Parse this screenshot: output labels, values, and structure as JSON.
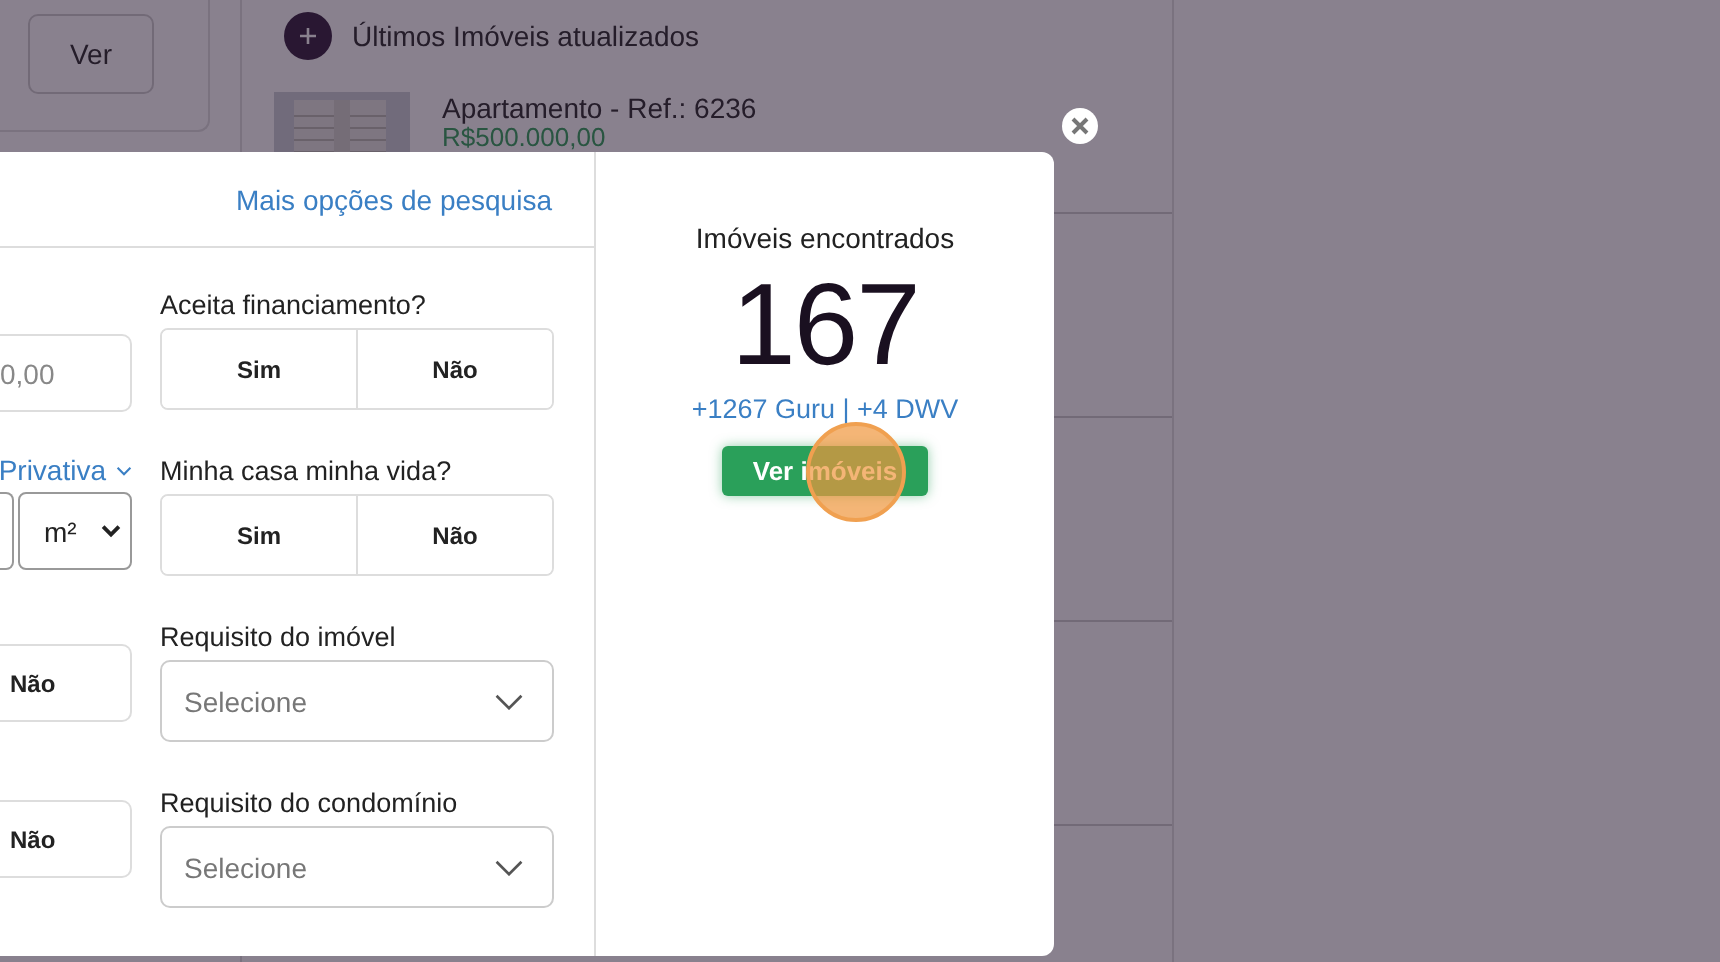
{
  "background": {
    "side_button": "Ver",
    "list_title": "Últimos Imóveis atualizados",
    "listing": {
      "title": "Apartamento - Ref.: 6236",
      "price": "R$500.000,00"
    }
  },
  "modal": {
    "more_link": "Mais opções de pesquisa",
    "price_field": {
      "value": "0,00"
    },
    "area_link": "Privativa",
    "unit_select": {
      "value": "m²"
    },
    "left_toggles": [
      {
        "label": "Não",
        "selected": false
      },
      {
        "label": "Não",
        "selected": false
      }
    ],
    "groups": [
      {
        "kind": "toggle",
        "label": "Aceita financiamento?",
        "options": [
          {
            "label": "Sim",
            "selected": false
          },
          {
            "label": "Não",
            "selected": false
          }
        ]
      },
      {
        "kind": "toggle",
        "label": "Minha casa minha vida?",
        "options": [
          {
            "label": "Sim",
            "selected": false
          },
          {
            "label": "Não",
            "selected": false
          }
        ]
      },
      {
        "kind": "select",
        "label": "Requisito do imóvel",
        "placeholder": "Selecione"
      },
      {
        "kind": "select",
        "label": "Requisito do condomínio",
        "placeholder": "Selecione"
      }
    ],
    "results": {
      "title": "Imóveis encontrados",
      "count": "167",
      "sources": "+1267 Guru | +4 DWV",
      "button": "Ver imóveis"
    }
  }
}
